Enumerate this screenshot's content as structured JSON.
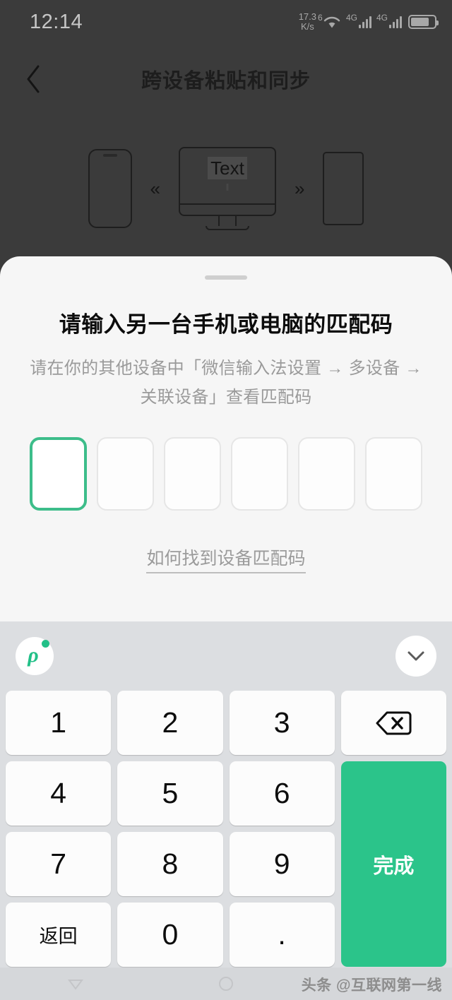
{
  "status_bar": {
    "time": "12:14",
    "net_speed_value": "17.3",
    "net_speed_unit": "K/s",
    "wifi_generation": "6",
    "sim1_label": "4G",
    "sim2_label": "4G",
    "wifi_icon": "wifi-icon",
    "battery_icon": "battery-icon"
  },
  "header": {
    "title": "跨设备粘贴和同步",
    "back_icon": "chevron-left-icon"
  },
  "illustration": {
    "left_device_icon": "phone-icon",
    "left_arrow": "«",
    "monitor_icon": "monitor-icon",
    "monitor_text": "Text",
    "right_arrow": "»",
    "right_device_icon": "tablet-icon"
  },
  "sheet": {
    "title": "请输入另一台手机或电脑的匹配码",
    "subtitle": "请在你的其他设备中「微信输入法设置 → 多设备 → 关联设备」查看匹配码",
    "help_link": "如何找到设备匹配码",
    "otp": {
      "length": 6,
      "active_index": 0,
      "values": [
        "",
        "",
        "",
        "",
        "",
        ""
      ],
      "active_border_color": "#3dbd8a",
      "idle_border_color": "#e6e6e6"
    }
  },
  "keyboard": {
    "toolbar": {
      "logo_icon": "ime-logo-icon",
      "logo_glyph": "ρ",
      "collapse_icon": "chevron-down-icon"
    },
    "accent_color": "#2bc48a",
    "keys": [
      {
        "label": "1",
        "name": "key-1",
        "type": "digit"
      },
      {
        "label": "2",
        "name": "key-2",
        "type": "digit"
      },
      {
        "label": "3",
        "name": "key-3",
        "type": "digit"
      },
      {
        "label": "",
        "name": "key-backspace",
        "type": "backspace"
      },
      {
        "label": "4",
        "name": "key-4",
        "type": "digit"
      },
      {
        "label": "5",
        "name": "key-5",
        "type": "digit"
      },
      {
        "label": "6",
        "name": "key-6",
        "type": "digit"
      },
      {
        "label": "7",
        "name": "key-7",
        "type": "digit"
      },
      {
        "label": "8",
        "name": "key-8",
        "type": "digit"
      },
      {
        "label": "9",
        "name": "key-9",
        "type": "digit"
      },
      {
        "label": "返回",
        "name": "key-return",
        "type": "function"
      },
      {
        "label": "0",
        "name": "key-0",
        "type": "digit"
      },
      {
        "label": ".",
        "name": "key-period",
        "type": "digit"
      }
    ],
    "done_key": {
      "label": "完成",
      "name": "key-done"
    }
  },
  "nav_bar": {
    "back_icon": "nav-back-triangle-icon",
    "home_icon": "nav-home-circle-icon",
    "recents_icon": "nav-recents-square-icon"
  },
  "watermark": "头条 @互联网第一线"
}
